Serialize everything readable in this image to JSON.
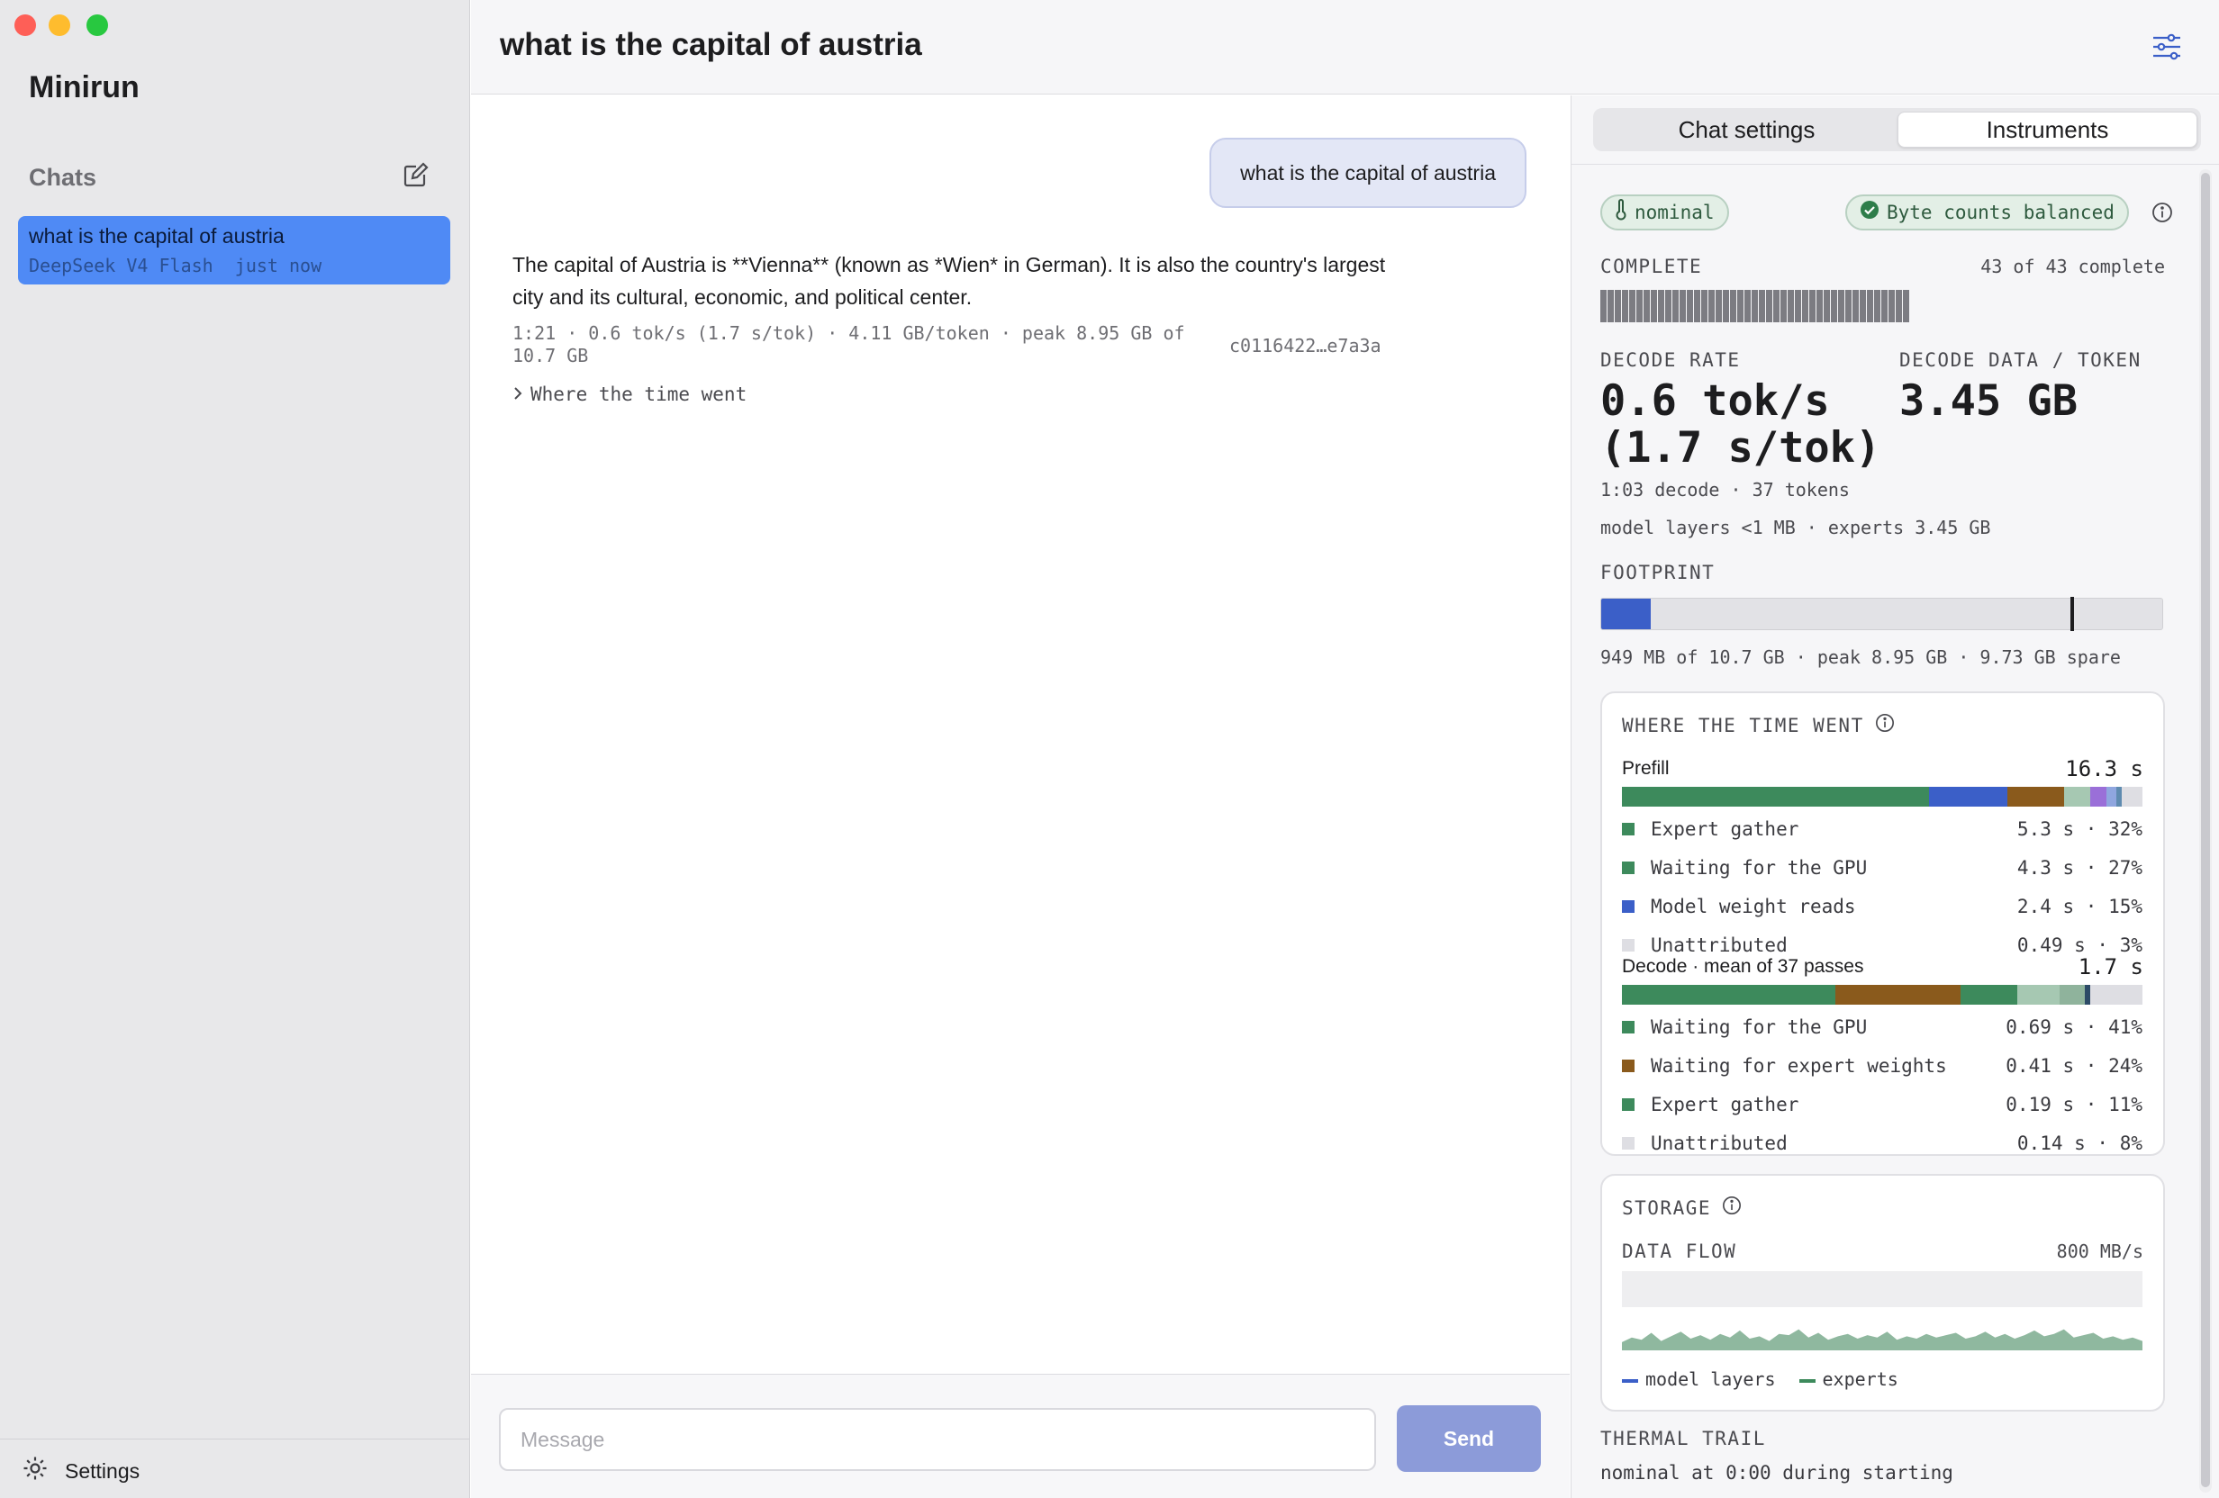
{
  "window": {
    "traffic_colors": [
      "#fe5f57",
      "#febc2e",
      "#28c840"
    ]
  },
  "sidebar": {
    "app_title": "Minirun",
    "chats_label": "Chats",
    "chats": [
      {
        "title": "what is the capital of austria",
        "subtitle": "DeepSeek V4 Flash  just now"
      }
    ],
    "settings_label": "Settings"
  },
  "header": {
    "title": "what is the capital of austria"
  },
  "chat": {
    "user_message": "what is the capital of austria",
    "assistant_message": "The capital of Austria is **Vienna** (known as *Wien* in German). It is also the country's largest city and its cultural, economic, and political center.",
    "meta": "1:21 · 0.6 tok/s (1.7 s/tok) · 4.11 GB/token · peak 8.95 GB of 10.7 GB",
    "hash": "c0116422…e7a3a",
    "disclosure": "Where the time went"
  },
  "composer": {
    "placeholder": "Message",
    "send_label": "Send"
  },
  "panel": {
    "tabs": [
      {
        "label": "Chat settings",
        "active": false
      },
      {
        "label": "Instruments",
        "active": true
      }
    ],
    "thermal_pill": "nominal",
    "balance_pill": "Byte counts balanced",
    "complete": {
      "label": "COMPLETE",
      "status": "43 of 43 complete",
      "done": 43,
      "total": 43
    },
    "decode_rate": {
      "label": "DECODE RATE",
      "line1": "0.6 tok/s",
      "line2": "(1.7 s/tok)"
    },
    "decode_data": {
      "label": "DECODE DATA / TOKEN",
      "value": "3.45 GB"
    },
    "decode_detail": "1:03 decode · 37 tokens",
    "layers_detail": "model layers <1 MB · experts 3.45 GB",
    "footprint": {
      "label": "FOOTPRINT",
      "text": "949 MB of 10.7 GB · peak 8.95 GB · 9.73 GB spare",
      "used_fraction": 0.089,
      "peak_fraction": 0.836
    },
    "time": {
      "title": "WHERE THE TIME WENT",
      "prefill": {
        "label": "Prefill",
        "total": "16.3 s",
        "segments": [
          {
            "color": "#3d8a5c",
            "pct": 59
          },
          {
            "color": "#3b5fc8",
            "pct": 15
          },
          {
            "color": "#8a5a1c",
            "pct": 11
          },
          {
            "color": "#a6c8b2",
            "pct": 5
          },
          {
            "color": "#9a6fd8",
            "pct": 3
          },
          {
            "color": "#8fa6df",
            "pct": 2
          },
          {
            "color": "#5f8bb0",
            "pct": 1
          },
          {
            "color": "#dedee3",
            "pct": 4
          }
        ],
        "items": [
          {
            "label": "Expert gather",
            "value": "5.3 s · 32%",
            "color": "#3d8a5c"
          },
          {
            "label": "Waiting for the GPU",
            "value": "4.3 s · 27%",
            "color": "#3d8a5c"
          },
          {
            "label": "Model weight reads",
            "value": "2.4 s · 15%",
            "color": "#3b5fc8"
          },
          {
            "label": "Unattributed",
            "value": "0.49 s · 3%",
            "color": "#dedee3"
          }
        ]
      },
      "decode": {
        "label": "Decode · mean of 37 passes",
        "total": "1.7 s",
        "segments": [
          {
            "color": "#3d8a5c",
            "pct": 41
          },
          {
            "color": "#8a5a1c",
            "pct": 24
          },
          {
            "color": "#3d8a5c",
            "pct": 11
          },
          {
            "color": "#a6c8b2",
            "pct": 8
          },
          {
            "color": "#8fb39c",
            "pct": 5
          },
          {
            "color": "#2c4a66",
            "pct": 1
          },
          {
            "color": "#dedee3",
            "pct": 10
          }
        ],
        "items": [
          {
            "label": "Waiting for the GPU",
            "value": "0.69 s · 41%",
            "color": "#3d8a5c"
          },
          {
            "label": "Waiting for expert weights",
            "value": "0.41 s · 24%",
            "color": "#8a5a1c"
          },
          {
            "label": "Expert gather",
            "value": "0.19 s · 11%",
            "color": "#3d8a5c"
          },
          {
            "label": "Unattributed",
            "value": "0.14 s · 8%",
            "color": "#dedee3"
          }
        ]
      }
    },
    "storage": {
      "title": "STORAGE",
      "data_flow_label": "DATA FLOW",
      "rate": "800 MB/s",
      "legend": [
        {
          "label": "model layers",
          "color": "#3b5fc8"
        },
        {
          "label": "experts",
          "color": "#3d8a5c"
        }
      ],
      "experts_flow": [
        0.35,
        0.55,
        0.45,
        0.75,
        0.4,
        0.6,
        0.8,
        0.5,
        0.65,
        0.45,
        0.7,
        0.55,
        0.85,
        0.5,
        0.6,
        0.4,
        0.7,
        0.65,
        0.9,
        0.55,
        0.75,
        0.45,
        0.6,
        0.7,
        0.5,
        0.65,
        0.55,
        0.8,
        0.45,
        0.6,
        0.5,
        0.7,
        0.55,
        0.65,
        0.75,
        0.5,
        0.6,
        0.8,
        0.55,
        0.7,
        0.5,
        0.65,
        0.85,
        0.6,
        0.7,
        0.9,
        0.55,
        0.65,
        0.75,
        0.5,
        0.6,
        0.45,
        0.55,
        0.4
      ]
    },
    "thermal_trail": {
      "label": "THERMAL TRAIL",
      "text": "nominal at 0:00 during starting"
    }
  }
}
